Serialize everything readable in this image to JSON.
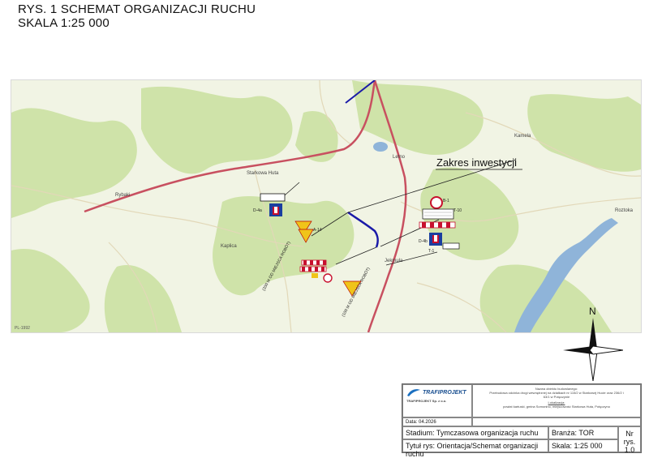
{
  "title": {
    "line1": "RYS. 1 SCHEMAT ORGANIZACJI RUCHU",
    "line2": "SKALA 1:25 000"
  },
  "map": {
    "annotation": "Zakres inwestycji",
    "places": [
      "Rybaki",
      "Starkowa Huta",
      "Kaplica",
      "Jekmula",
      "Kamela",
      "Roztoka",
      "Letno"
    ],
    "signs": [
      "D-4a",
      "A-14",
      "B-1",
      "T-10",
      "T-1",
      "D-4b"
    ],
    "distance_labels": [
      "(200 M OD MIEJSCA ROBÓT)",
      "(100 M OD MIEJSCA ROBÓT)"
    ],
    "north": "N",
    "scale_label": "PL-1992"
  },
  "titleblock": {
    "company": "TRAFIPROJEKT",
    "company_full": "TRAFIPROJEKT Sp. z o.o.",
    "object_label": "Nazwa obiektu budowlanego:",
    "object_value": "Przebudowa odcinka drogi wewnętrznej na działkach nr 115/2 w Starkowej Hucie oraz 236/2 i 63/1 w Potęczynie",
    "location_label": "Lokalizacja:",
    "location_value": "powiat kartuski, gmina Somonino, miejscowość Starkowa Huta, Potęczyno",
    "date": "Data: 04.2026",
    "stage": "Stadium: Tymczasowa organizacja ruchu",
    "branch": "Branża: TOR",
    "drawing_title": "Tytuł rys: Orientacja/Schemat organizacji ruchu",
    "scale": "Skala: 1:25 000",
    "nr_label": "Nr rys.",
    "nr_value": "1.0"
  },
  "colors": {
    "road_red": "#c85060",
    "investment_blue": "#1a1aa8",
    "forest": "#cfe3a9",
    "field": "#f1f4e4",
    "lake": "#8fb4d9"
  }
}
